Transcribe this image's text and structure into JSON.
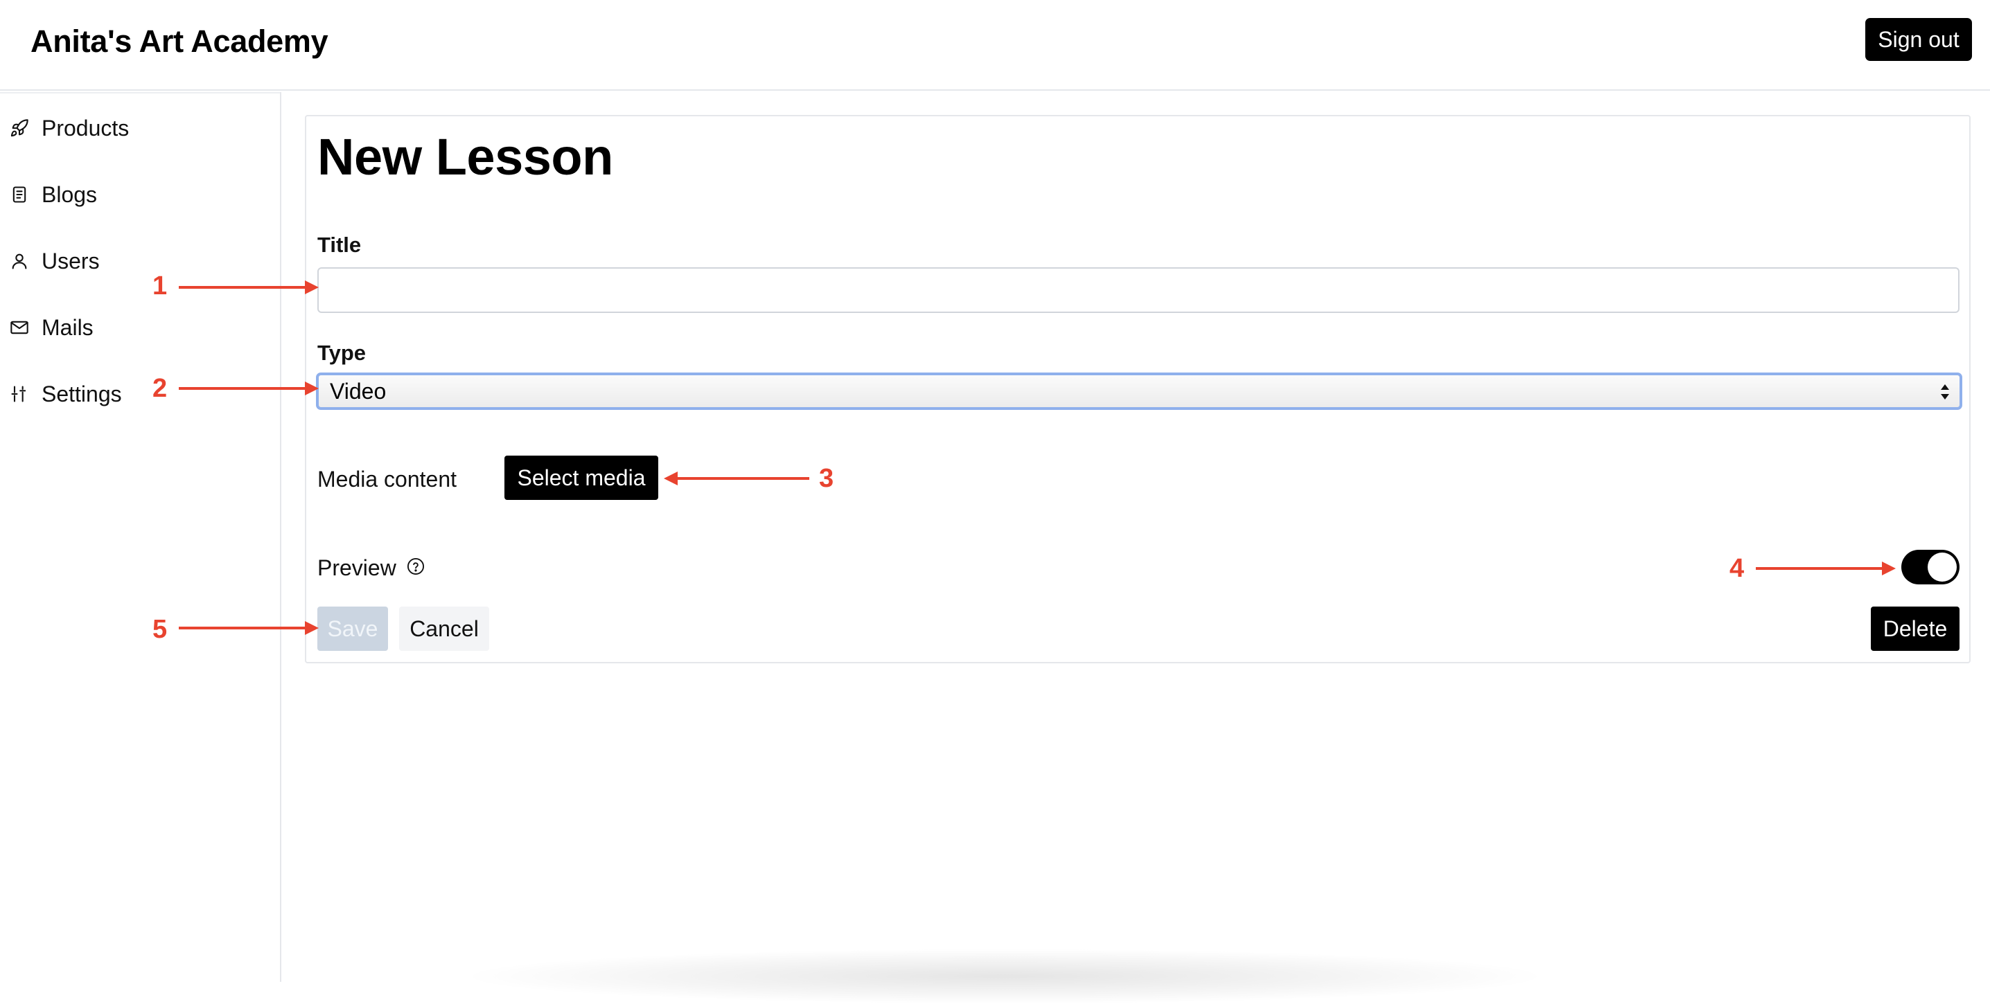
{
  "header": {
    "app_title": "Anita's Art Academy",
    "sign_out_label": "Sign out"
  },
  "sidebar": {
    "items": [
      {
        "label": "Products",
        "icon": "rocket-icon"
      },
      {
        "label": "Blogs",
        "icon": "document-icon"
      },
      {
        "label": "Users",
        "icon": "user-icon"
      },
      {
        "label": "Mails",
        "icon": "mail-icon"
      },
      {
        "label": "Settings",
        "icon": "sliders-icon"
      }
    ]
  },
  "form": {
    "page_title": "New Lesson",
    "title_label": "Title",
    "title_value": "",
    "type_label": "Type",
    "type_selected": "Video",
    "media_label": "Media content",
    "select_media_label": "Select media",
    "preview_label": "Preview",
    "preview_enabled": true,
    "save_label": "Save",
    "cancel_label": "Cancel",
    "delete_label": "Delete"
  },
  "annotations": {
    "markers": [
      "1",
      "2",
      "3",
      "4",
      "5"
    ],
    "color": "#e8432f"
  },
  "colors": {
    "primary": "#000000",
    "disabled": "#cbd5e1",
    "focus_ring": "#8fb0ec",
    "border": "#e5e7eb"
  }
}
